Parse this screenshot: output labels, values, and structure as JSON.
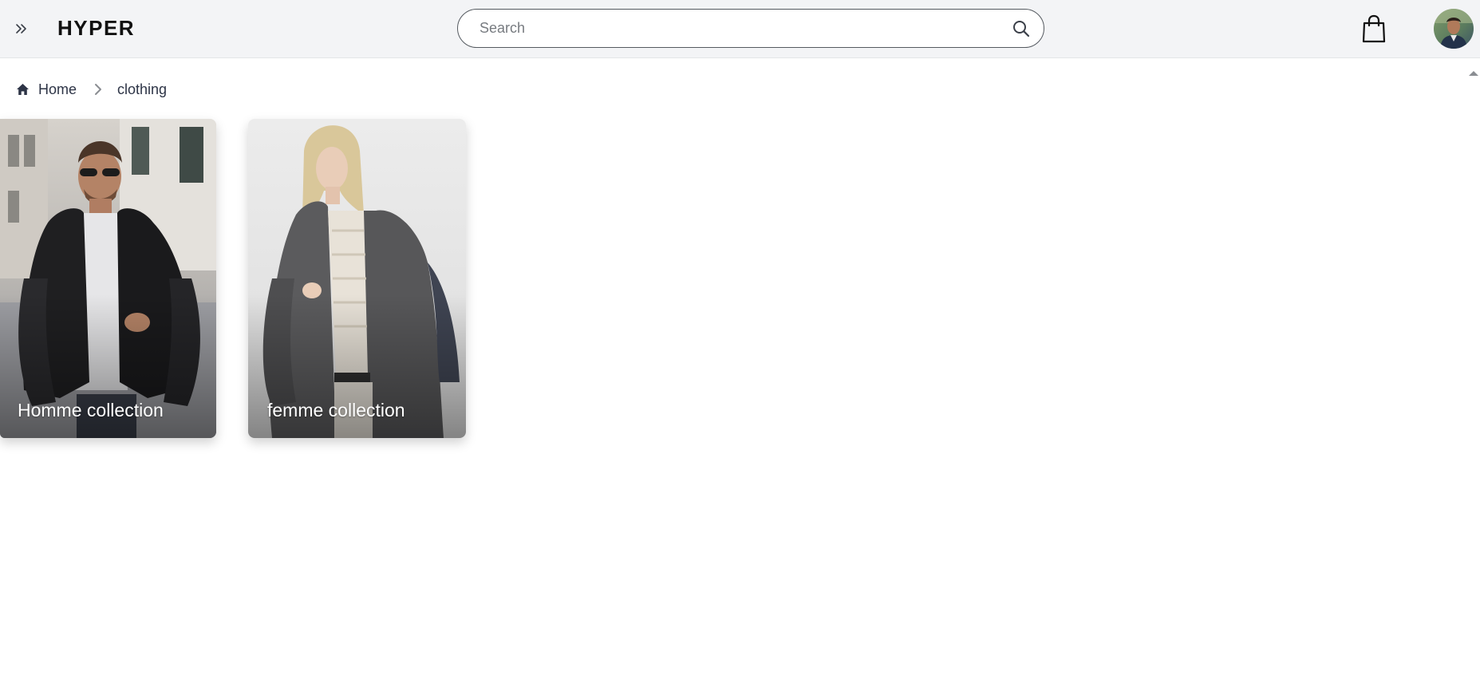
{
  "header": {
    "brand": "HYPER",
    "search": {
      "placeholder": "Search",
      "value": ""
    },
    "icons": {
      "menu": "double-chevron-right-icon",
      "search": "search-icon",
      "cart": "shopping-bag-icon",
      "avatar": "user-avatar"
    }
  },
  "breadcrumb": {
    "home_label": "Home",
    "current_label": "clothing",
    "icons": {
      "home": "home-icon",
      "separator": "chevron-right-icon"
    }
  },
  "collections": [
    {
      "label": "Homme collection"
    },
    {
      "label": "femme collection"
    }
  ],
  "colors": {
    "header_bg": "#f3f4f6",
    "text_primary": "#2d3446",
    "brand_text": "#111111"
  }
}
